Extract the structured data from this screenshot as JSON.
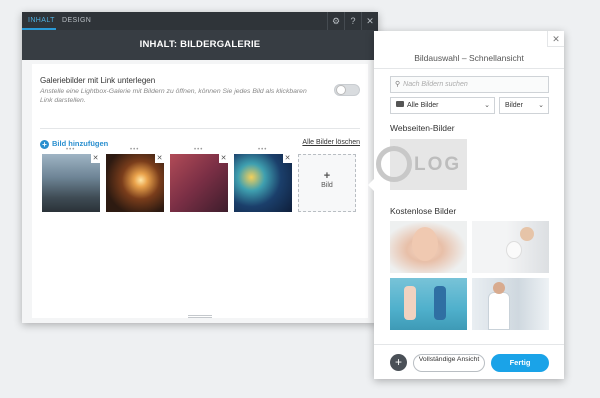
{
  "dialog": {
    "tabs": [
      {
        "label": "INHALT"
      },
      {
        "label": "DESIGN"
      }
    ],
    "title": "INHALT: BILDERGALERIE",
    "option_title": "Galeriebilder mit Link unterlegen",
    "option_desc": "Anstelle eine Lightbox-Galerie mit Bildern zu öffnen, können Sie jedes Bild als klickbaren Link darstellen.",
    "add_image_label": "Bild hinzufügen",
    "clear_all_label": "Alle Bilder löschen",
    "add_box_label": "Bild",
    "help_label": "?"
  },
  "picker": {
    "title": "Bildauswahl – Schnellansicht",
    "search_placeholder": "Nach Bildern suchen",
    "filter_all": "Alle Bilder",
    "filter_type": "Bilder",
    "section_website": "Webseiten-Bilder",
    "logo_text": "LOG",
    "section_free": "Kostenlose Bilder",
    "full_view_label": "Vollständige Ansicht",
    "done_label": "Fertig"
  }
}
